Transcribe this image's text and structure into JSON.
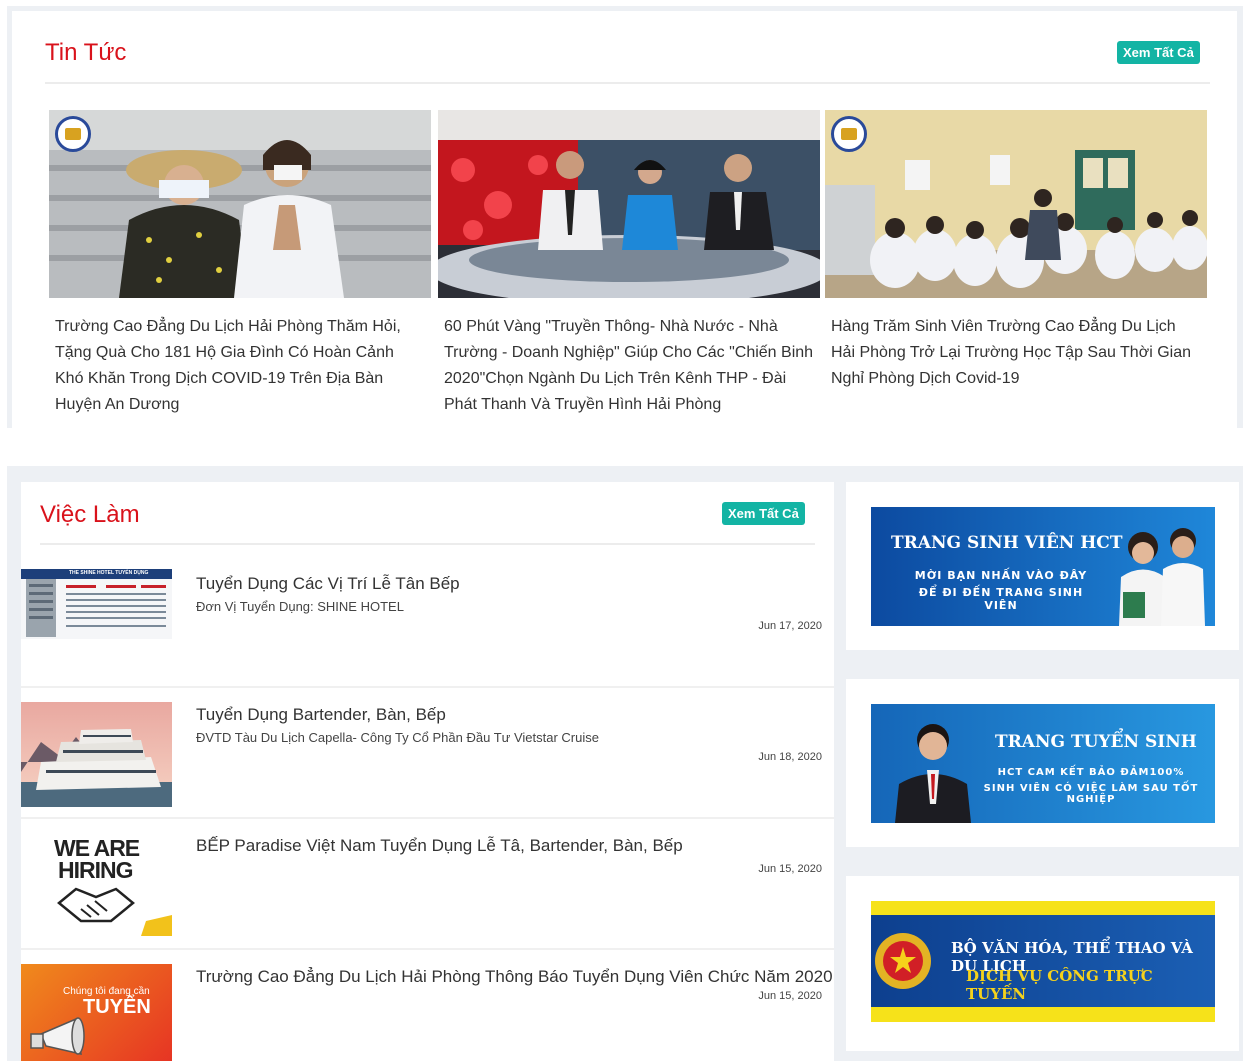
{
  "news": {
    "title": "Tin Tức",
    "see_all": "Xem Tất Cả",
    "items": [
      {
        "caption": "Trường Cao Đẳng Du Lịch Hải Phòng Thăm Hỏi, Tặng Quà Cho 181 Hộ Gia Đình Có Hoàn Cảnh Khó Khăn Trong Dịch COVID-19 Trên Địa Bàn Huyện An Dương"
      },
      {
        "caption": "60 Phút Vàng \"Truyền Thông- Nhà Nước - Nhà Trường - Doanh Nghiệp\" Giúp Cho Các \"Chiến Binh 2020\"Chọn Ngành Du Lịch Trên Kênh THP - Đài Phát Thanh Và Truyền Hình Hải Phòng"
      },
      {
        "caption": "Hàng Trăm Sinh Viên Trường Cao Đẳng Du Lịch Hải Phòng Trở Lại Trường Học Tập Sau Thời Gian Nghỉ Phòng Dịch Covid-19"
      }
    ]
  },
  "jobs": {
    "title": "Việc Làm",
    "see_all": "Xem Tất Cả",
    "items": [
      {
        "title": "Tuyển Dụng Các Vị Trí Lễ Tân Bếp",
        "sub": "Đơn Vị Tuyển Dụng: SHINE HOTEL",
        "date": "Jun 17, 2020",
        "thumb_text": "THE SHINE HOTEL TUYỂN DỤNG"
      },
      {
        "title": "Tuyển Dụng Bartender, Bàn, Bếp",
        "sub": "ĐVTD Tàu Du Lịch Capella- Công Ty Cổ Phần Đầu Tư Vietstar Cruise",
        "date": "Jun 18, 2020"
      },
      {
        "title": "BẾP Paradise Việt Nam Tuyển Dụng Lễ Tâ, Bartender, Bàn, Bếp",
        "sub": "",
        "date": "Jun 15, 2020",
        "thumb_text1": "WE ARE",
        "thumb_text2": "HIRING"
      },
      {
        "title": "Trường Cao Đẳng Du Lịch Hải Phòng Thông Báo Tuyển Dụng Viên Chức Năm 2020",
        "sub": "",
        "date": "Jun 15, 2020",
        "thumb_text1": "Chúng tôi đang cần",
        "thumb_text2": "TUYỂN"
      }
    ]
  },
  "banners": [
    {
      "line1": "TRANG SINH VIÊN HCT",
      "line2": "MỜI BẠN NHẤN VÀO ĐÂY",
      "line3": "ĐỂ ĐI ĐẾN TRANG SINH VIÊN"
    },
    {
      "line1": "TRANG TUYỂN SINH",
      "line2": "HCT CAM KẾT BẢO ĐẢM100%",
      "line3": "SINH VIÊN CÓ VIỆC LÀM SAU TỐT NGHIỆP"
    },
    {
      "line1": "BỘ VĂN HÓA, THỂ THAO VÀ DU LỊCH",
      "line2": "DỊCH VỤ CÔNG TRỰC TUYẾN"
    }
  ],
  "colors": {
    "accent_red": "#d9121b",
    "see_all_bg": "#13b4a4",
    "banner_blue": "#1a6fc4"
  }
}
